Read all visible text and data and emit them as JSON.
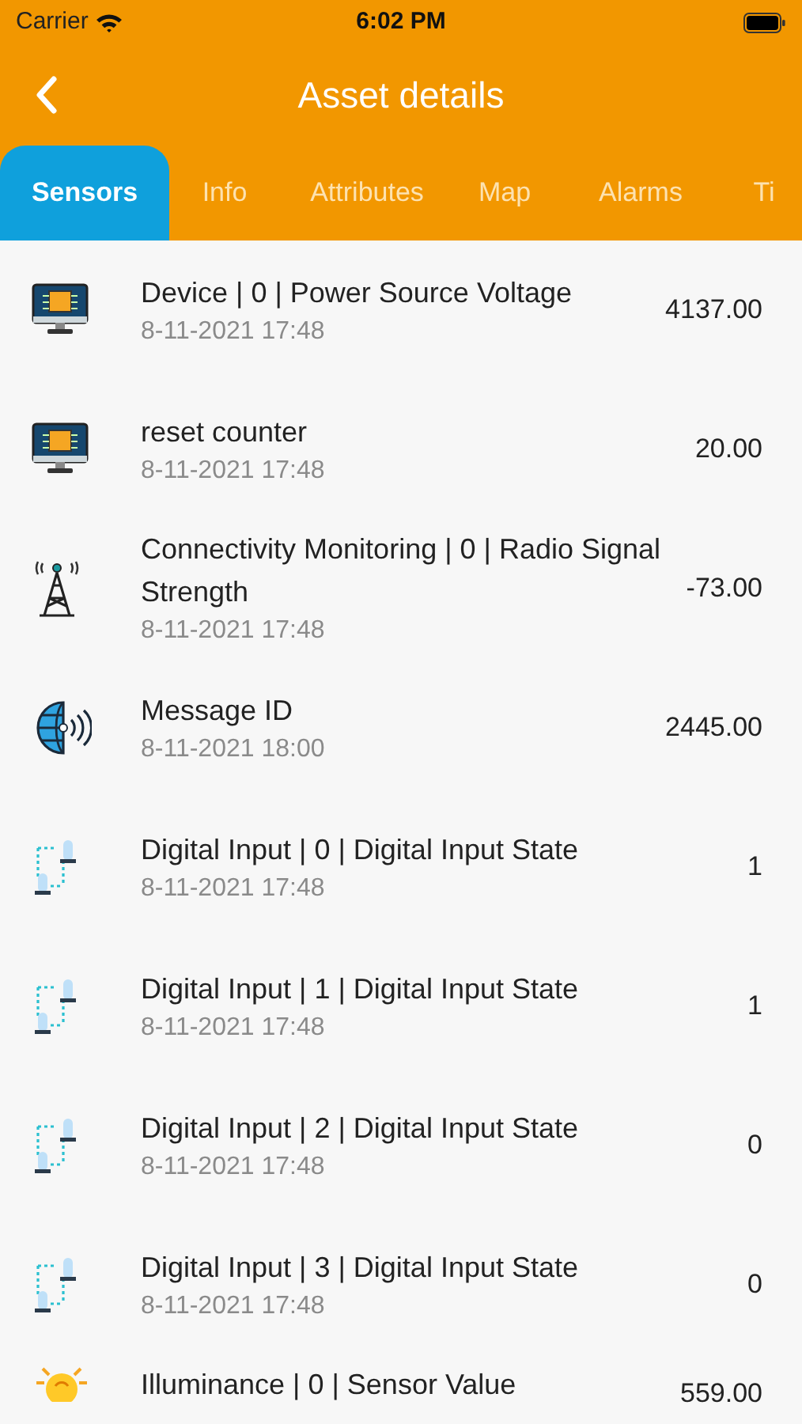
{
  "status_bar": {
    "carrier": "Carrier",
    "time": "6:02 PM"
  },
  "nav": {
    "title": "Asset details"
  },
  "tabs": [
    {
      "label": "Sensors",
      "selected": true
    },
    {
      "label": "Info",
      "selected": false
    },
    {
      "label": "Attributes",
      "selected": false
    },
    {
      "label": "Map",
      "selected": false
    },
    {
      "label": "Alarms",
      "selected": false
    },
    {
      "label": "Ti",
      "selected": false
    }
  ],
  "sensors": [
    {
      "kind": "monitor",
      "name": "Device | 0 | Power Source Voltage",
      "time": "8-11-2021 17:48",
      "value": "4137.00"
    },
    {
      "kind": "monitor",
      "name": "reset counter",
      "time": "8-11-2021 17:48",
      "value": "20.00"
    },
    {
      "kind": "tower",
      "name": "Connectivity Monitoring | 0 | Radio Signal Strength",
      "time": "8-11-2021 17:48",
      "value": "-73.00"
    },
    {
      "kind": "globe",
      "name": "Message ID",
      "time": "8-11-2021 18:00",
      "value": "2445.00"
    },
    {
      "kind": "digital",
      "name": "Digital Input | 0 | Digital Input State",
      "time": "8-11-2021 17:48",
      "value": "1"
    },
    {
      "kind": "digital",
      "name": "Digital Input | 1 | Digital Input State",
      "time": "8-11-2021 17:48",
      "value": "1"
    },
    {
      "kind": "digital",
      "name": "Digital Input | 2 | Digital Input State",
      "time": "8-11-2021 17:48",
      "value": "0"
    },
    {
      "kind": "digital",
      "name": "Digital Input | 3 | Digital Input State",
      "time": "8-11-2021 17:48",
      "value": "0"
    },
    {
      "kind": "bulb",
      "name": "Illuminance | 0 | Sensor Value",
      "value": "559.00"
    }
  ]
}
